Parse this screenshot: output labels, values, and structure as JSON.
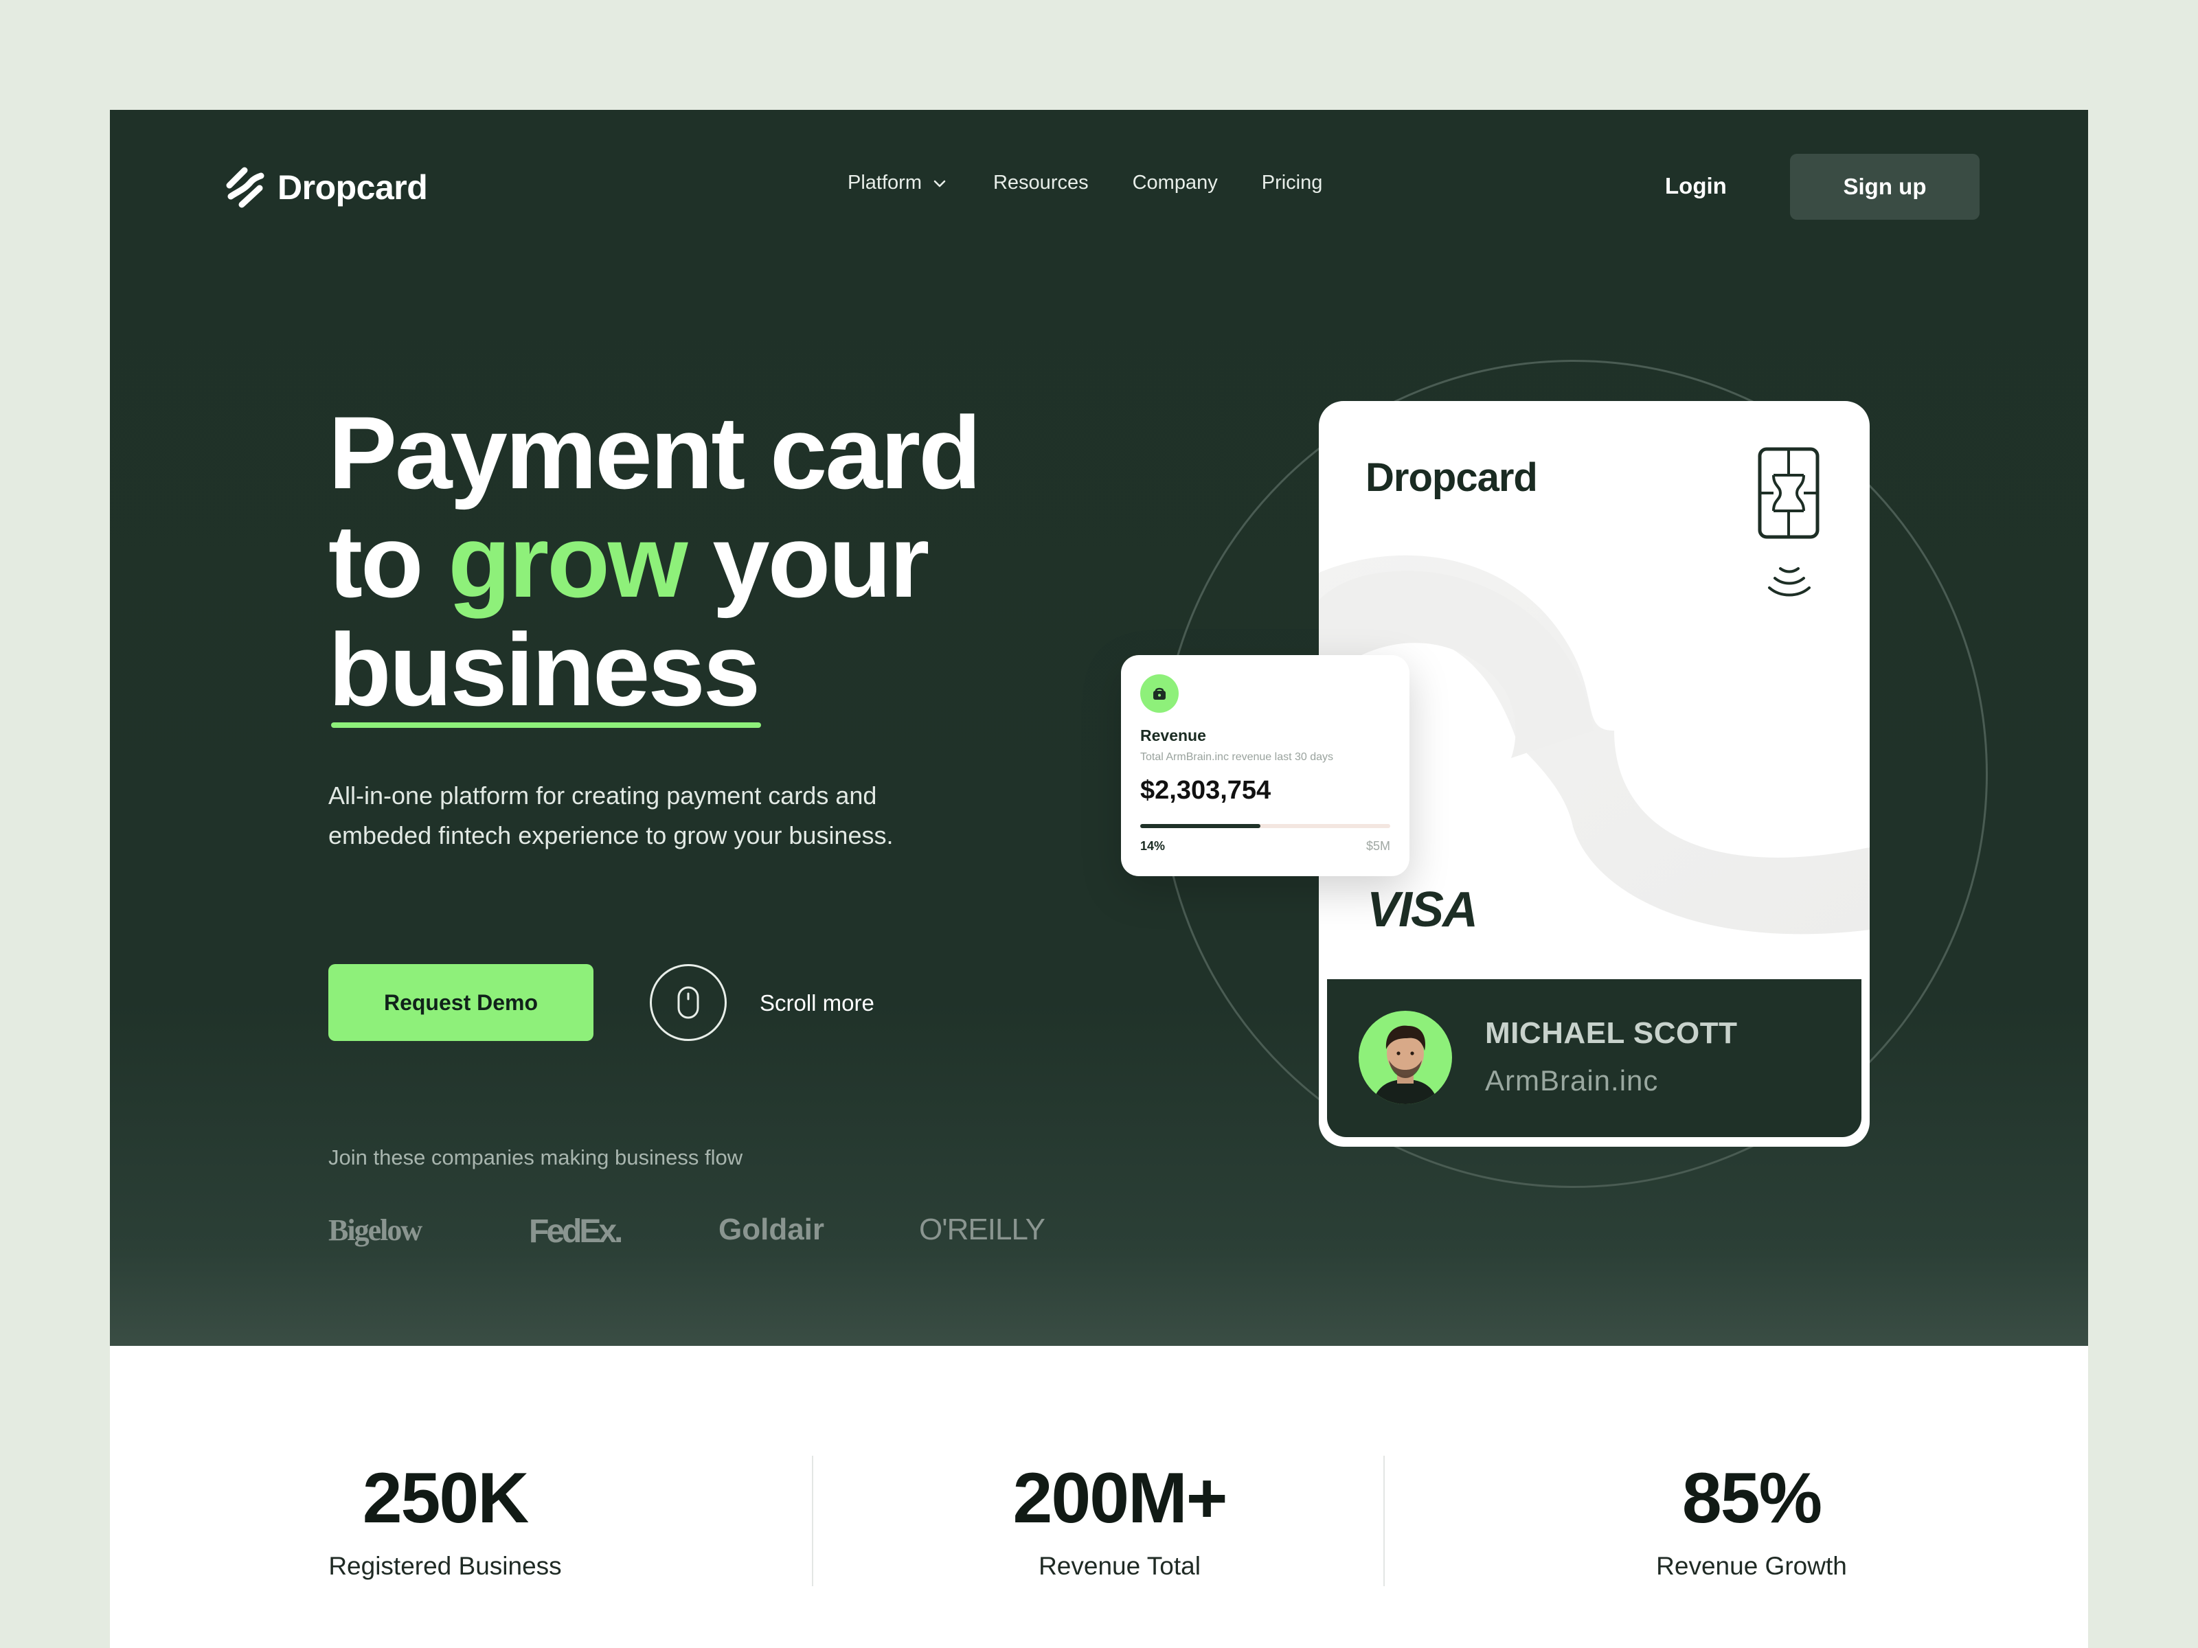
{
  "nav": {
    "brand": "Dropcard",
    "items": [
      {
        "label": "Platform",
        "has_dropdown": true
      },
      {
        "label": "Resources"
      },
      {
        "label": "Company"
      },
      {
        "label": "Pricing"
      }
    ],
    "login": "Login",
    "signup": "Sign up"
  },
  "hero": {
    "line1": "Payment card",
    "line2_prefix": "to ",
    "line2_highlight": "grow",
    "line2_suffix": " your",
    "line3": "business",
    "subtitle": "All-in-one platform for creating payment cards and embeded fintech experience to grow your business.",
    "cta": "Request Demo",
    "scroll": "Scroll more",
    "join_text": "Join these companies making business flow",
    "partners": [
      "Bigelow",
      "FedEx.",
      "Goldair",
      "O'REILLY"
    ]
  },
  "card": {
    "brand": "Dropcard",
    "network": "VISA",
    "holder_name": "MICHAEL SCOTT",
    "holder_company": "ArmBrain.inc"
  },
  "revenue": {
    "title": "Revenue",
    "subtitle": "Total ArmBrain.inc revenue last 30 days",
    "value": "$2,303,754",
    "progress_label": "14%",
    "progress_fraction": 0.48,
    "max_label": "$5M"
  },
  "stats": [
    {
      "value": "250K",
      "label": "Registered Business"
    },
    {
      "value": "200M+",
      "label": "Revenue Total"
    },
    {
      "value": "85%",
      "label": "Revenue Growth"
    }
  ],
  "colors": {
    "dark_green": "#1f3128",
    "accent_green": "#8ef07a",
    "background": "#e4ebe1"
  }
}
